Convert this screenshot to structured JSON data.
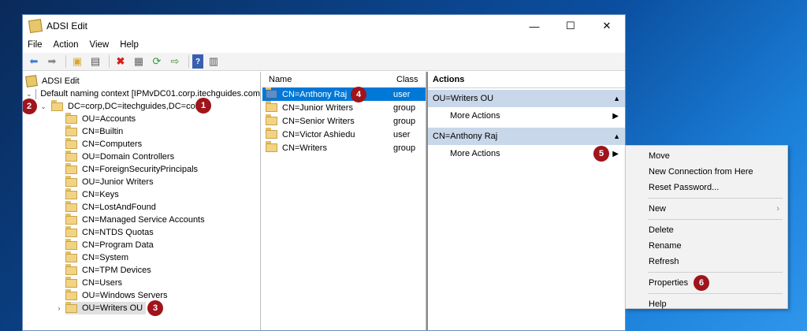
{
  "window": {
    "title": "ADSI Edit",
    "controls": [
      "—",
      "☐",
      "✕"
    ]
  },
  "menu": [
    "File",
    "Action",
    "View",
    "Help"
  ],
  "toolbar_icons": [
    "back-icon",
    "forward-icon",
    "up-folder-icon",
    "show-hide-tree-icon",
    "delete-icon",
    "properties-icon",
    "refresh-icon",
    "export-icon",
    "help-icon",
    "action-pane-icon"
  ],
  "tree": {
    "root": "ADSI Edit",
    "context": "Default naming context [IPMvDC01.corp.itechguides.com",
    "domain": "DC=corp,DC=itechguides,DC=com",
    "children": [
      "OU=Accounts",
      "CN=Builtin",
      "CN=Computers",
      "OU=Domain Controllers",
      "CN=ForeignSecurityPrincipals",
      "OU=Junior Writers",
      "CN=Keys",
      "CN=LostAndFound",
      "CN=Managed Service Accounts",
      "CN=NTDS Quotas",
      "CN=Program Data",
      "CN=System",
      "CN=TPM Devices",
      "CN=Users",
      "OU=Windows Servers",
      "OU=Writers OU"
    ]
  },
  "list": {
    "headers": {
      "name": "Name",
      "class": "Class"
    },
    "rows": [
      {
        "name": "CN=Anthony Raj",
        "class": "user"
      },
      {
        "name": "CN=Junior Writers",
        "class": "group"
      },
      {
        "name": "CN=Senior Writers",
        "class": "group"
      },
      {
        "name": "CN=Victor Ashiedu",
        "class": "user"
      },
      {
        "name": "CN=Writers",
        "class": "group"
      }
    ]
  },
  "actions": {
    "title": "Actions",
    "group1": "OU=Writers OU",
    "group2": "CN=Anthony Raj",
    "more": "More Actions"
  },
  "context_menu": {
    "items": [
      "Move",
      "New Connection from Here",
      "Reset Password...",
      "New",
      "Delete",
      "Rename",
      "Refresh",
      "Properties",
      "Help"
    ]
  },
  "badges": [
    "1",
    "2",
    "3",
    "4",
    "5",
    "6"
  ],
  "colors": {
    "selection": "#0078d7",
    "badge": "#a0141b",
    "group_header": "#c9d7ea"
  }
}
